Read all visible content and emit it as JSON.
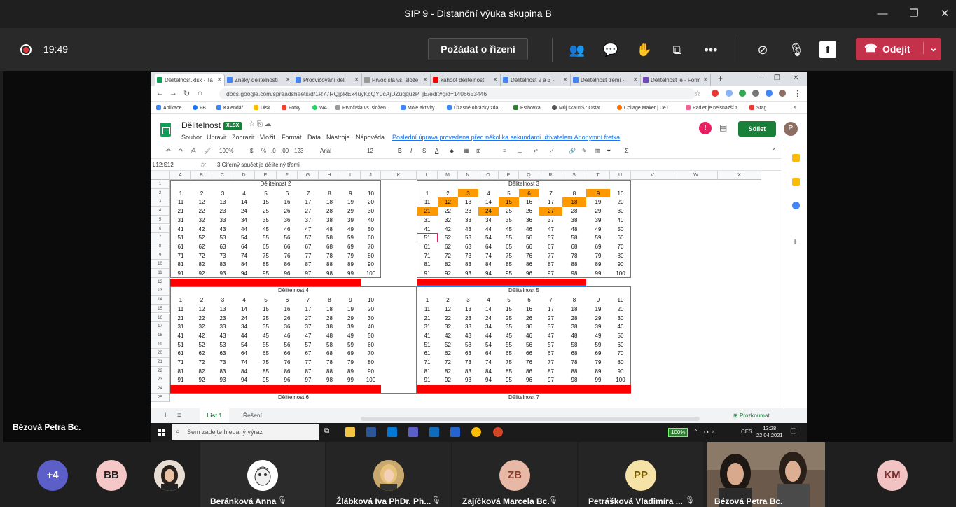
{
  "window": {
    "title": "SIP 9 - Distanční výuka skupina B"
  },
  "call": {
    "time": "19:49",
    "control_label": "Požádat o řízení",
    "leave_label": "Odejít",
    "presenter": "Bézová Petra Bc."
  },
  "browser": {
    "tabs": [
      "Dělitelnost.xlsx - Ta",
      "Znaky dělitelnosti",
      "Procvičování děli",
      "Prvočísla vs. slože",
      "kahoot dělitelnost",
      "Dělitelnost 2 a 3 -",
      "Dělitelnost třemi -",
      "Dělitelnost je - Form"
    ],
    "url": "docs.google.com/spreadsheets/d/1R77RQjpREx4uyKcQY0cAjDZuqquzP_jE/edit#gid=1406653446",
    "bookmarks": [
      "Aplikace",
      "FB",
      "Kalendář",
      "Disk",
      "Fotky",
      "WA",
      "Prvočísla vs. složen...",
      "Moje aktivity",
      "Úžasné obrázky zda...",
      "Esthovka",
      "Můj skautIS : Ostat...",
      "Collage Maker | DeT...",
      "Padlet je nejsnazší z...",
      "Stag"
    ]
  },
  "sheets": {
    "doc_title": "Dělitelnost",
    "badge": "XLSX",
    "menu": [
      "Soubor",
      "Upravit",
      "Zobrazit",
      "Vložit",
      "Formát",
      "Data",
      "Nástroje",
      "Nápověda"
    ],
    "last_edit": "Poslední úprava provedena před několika sekundami uživatelem Anonymní fretka",
    "share": "Sdílet",
    "avatar": "P",
    "toolbar": {
      "zoom": "100%",
      "currency": "$",
      "percent": "%",
      "dec1": ".0",
      "dec2": ".00",
      "fmt": "123",
      "font": "Arial",
      "size": "12"
    },
    "namebox": "L12:S12",
    "fx": "fx",
    "formula": "3   Ciferný součet je dělitelný třemi",
    "columns": [
      "A",
      "B",
      "C",
      "D",
      "E",
      "F",
      "G",
      "H",
      "I",
      "J",
      "K",
      "L",
      "M",
      "N",
      "O",
      "P",
      "Q",
      "R",
      "S",
      "T",
      "U",
      "V",
      "W",
      "X"
    ],
    "rows": [
      "1",
      "2",
      "3",
      "4",
      "5",
      "6",
      "7",
      "8",
      "9",
      "10",
      "11",
      "12",
      "13",
      "14",
      "15",
      "16",
      "17",
      "18",
      "19",
      "20",
      "21",
      "22",
      "23",
      "24",
      "25"
    ],
    "tables": [
      "Dělitelnost 2",
      "Dělitelnost 3",
      "Dělitelnost 4",
      "Dělitelnost 5",
      "Dělitelnost 6",
      "Dělitelnost 7"
    ],
    "highlight_div3": [
      3,
      6,
      9,
      12,
      15,
      18,
      21,
      24,
      27
    ],
    "sheet_tabs": [
      "List 1",
      "Řešení"
    ],
    "explore": "Prozkoumat"
  },
  "taskbar": {
    "search": "Sem zadejte hledaný výraz",
    "battery": "100%",
    "lang": "CES",
    "time": "13:28",
    "date": "22.04.2021"
  },
  "participants": [
    {
      "initials": "+4",
      "color": "#5b5fc7"
    },
    {
      "initials": "BB",
      "color": "#f6c7c7"
    },
    {
      "name": "Beránková Anna"
    },
    {
      "name": "Žlábková Iva PhDr. Ph..."
    },
    {
      "initials": "ZB",
      "name": "Zajíčková Marcela Bc.",
      "color": "#e8b8a6"
    },
    {
      "initials": "PP",
      "name": "Petrášková Vladimíra ...",
      "color": "#f5e2a6"
    },
    {
      "name": "Bézová Petra Bc."
    },
    {
      "initials": "KM",
      "color": "#f1c3c3"
    }
  ]
}
